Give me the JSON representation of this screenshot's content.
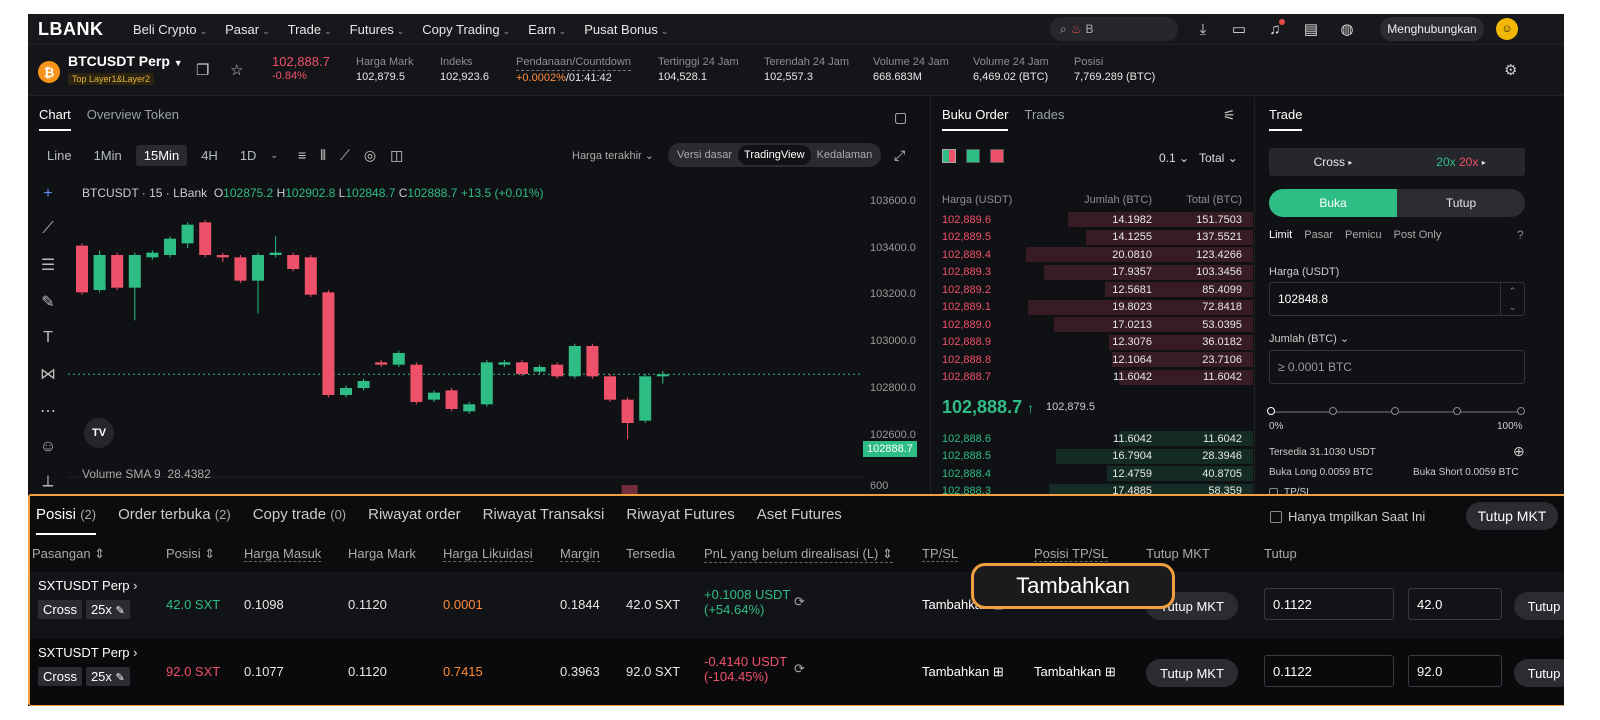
{
  "nav": {
    "logo": "LBANK",
    "items": [
      "Beli Crypto",
      "Pasar",
      "Trade",
      "Futures",
      "Copy Trading",
      "Earn",
      "Pusat Bonus"
    ],
    "search_value": "B",
    "connect_label": "Menghubungkan"
  },
  "ticker": {
    "pair": "BTCUSDT Perp",
    "tags": "Top  Layer1&Layer2",
    "last_price": "102,888.7",
    "change": "-0.84%",
    "stats": [
      {
        "label": "Harga Mark",
        "value": "102,879.5"
      },
      {
        "label": "Indeks",
        "value": "102,923.6"
      },
      {
        "label": "Pendanaan/Countdown",
        "value_a": "+0.0002%",
        "value_b": "/01:41:42"
      },
      {
        "label": "Tertinggi 24 Jam",
        "value": "104,528.1"
      },
      {
        "label": "Terendah 24 Jam",
        "value": "102,557.3"
      },
      {
        "label": "Volume 24 Jam",
        "value": "668.683M"
      },
      {
        "label": "Volume 24 Jam",
        "value": "6,469.02 (BTC)"
      },
      {
        "label": "Posisi",
        "value": "7,769.289 (BTC)"
      }
    ]
  },
  "chart": {
    "tabs": [
      "Chart",
      "Overview Token"
    ],
    "timeframes": [
      "Line",
      "1Min",
      "15Min",
      "4H",
      "1D"
    ],
    "active_timeframe": "15Min",
    "price_type": "Harga terakhir",
    "views": [
      "Versi dasar",
      "TradingView",
      "Kedalaman"
    ],
    "ohlc": {
      "title": "BTCUSDT · 15 · LBank",
      "o": "102875.2",
      "h": "102902.8",
      "l": "102848.7",
      "c": "102888.7",
      "chg": "+13.5 (+0.01%)"
    },
    "price_scale": [
      "103600.0",
      "103400.0",
      "103200.0",
      "103000.0",
      "102800.0",
      "102600.0",
      "600"
    ],
    "current_price_tag": "102888.7",
    "volume_label": "Volume SMA 9",
    "volume_value": "28.4382",
    "tv_logo": "TV"
  },
  "chart_data": {
    "type": "candlestick",
    "title": "BTCUSDT · 15 · LBank",
    "y_range": [
      102500,
      103700
    ],
    "candles": [
      {
        "o": 103440,
        "c": 103240,
        "h": 103450,
        "l": 103230
      },
      {
        "o": 103250,
        "c": 103400,
        "h": 103420,
        "l": 103240
      },
      {
        "o": 103400,
        "c": 103260,
        "h": 103410,
        "l": 103250
      },
      {
        "o": 103260,
        "c": 103400,
        "h": 103410,
        "l": 103120
      },
      {
        "o": 103390,
        "c": 103410,
        "h": 103420,
        "l": 103380
      },
      {
        "o": 103400,
        "c": 103470,
        "h": 103480,
        "l": 103390
      },
      {
        "o": 103450,
        "c": 103530,
        "h": 103540,
        "l": 103430
      },
      {
        "o": 103540,
        "c": 103400,
        "h": 103550,
        "l": 103390
      },
      {
        "o": 103400,
        "c": 103390,
        "h": 103410,
        "l": 103370
      },
      {
        "o": 103390,
        "c": 103290,
        "h": 103400,
        "l": 103280
      },
      {
        "o": 103290,
        "c": 103400,
        "h": 103410,
        "l": 103150
      },
      {
        "o": 103400,
        "c": 103410,
        "h": 103480,
        "l": 103390
      },
      {
        "o": 103400,
        "c": 103340,
        "h": 103410,
        "l": 103330
      },
      {
        "o": 103390,
        "c": 103230,
        "h": 103400,
        "l": 103220
      },
      {
        "o": 103240,
        "c": 102800,
        "h": 103250,
        "l": 102790
      },
      {
        "o": 102800,
        "c": 102830,
        "h": 102840,
        "l": 102790
      },
      {
        "o": 102830,
        "c": 102860,
        "h": 102870,
        "l": 102820
      },
      {
        "o": 102940,
        "c": 102930,
        "h": 102950,
        "l": 102920
      },
      {
        "o": 102930,
        "c": 102980,
        "h": 102990,
        "l": 102920
      },
      {
        "o": 102930,
        "c": 102770,
        "h": 102940,
        "l": 102760
      },
      {
        "o": 102780,
        "c": 102810,
        "h": 102820,
        "l": 102770
      },
      {
        "o": 102820,
        "c": 102740,
        "h": 102830,
        "l": 102730
      },
      {
        "o": 102730,
        "c": 102760,
        "h": 102770,
        "l": 102720
      },
      {
        "o": 102760,
        "c": 102940,
        "h": 102950,
        "l": 102750
      },
      {
        "o": 102930,
        "c": 102940,
        "h": 102950,
        "l": 102920
      },
      {
        "o": 102940,
        "c": 102890,
        "h": 102950,
        "l": 102880
      },
      {
        "o": 102900,
        "c": 102920,
        "h": 102930,
        "l": 102890
      },
      {
        "o": 102930,
        "c": 102880,
        "h": 102940,
        "l": 102870
      },
      {
        "o": 102880,
        "c": 103010,
        "h": 103020,
        "l": 102870
      },
      {
        "o": 103010,
        "c": 102880,
        "h": 103020,
        "l": 102870
      },
      {
        "o": 102880,
        "c": 102780,
        "h": 102890,
        "l": 102770
      },
      {
        "o": 102780,
        "c": 102680,
        "h": 102790,
        "l": 102610
      },
      {
        "o": 102690,
        "c": 102880,
        "h": 102890,
        "l": 102680
      },
      {
        "o": 102880,
        "c": 102888.7,
        "h": 102902.8,
        "l": 102848.7
      }
    ]
  },
  "orderbook": {
    "tabs": [
      "Buku Order",
      "Trades"
    ],
    "tick": "0.1",
    "mode": "Total",
    "headers": [
      "Harga (USDT)",
      "Jumlah (BTC)",
      "Total (BTC)"
    ],
    "asks": [
      {
        "p": "102,889.6",
        "a": "14.1982",
        "t": "151.7503",
        "d": 0.8
      },
      {
        "p": "102,889.5",
        "a": "14.1255",
        "t": "137.5521",
        "d": 0.72
      },
      {
        "p": "102,889.4",
        "a": "20.0810",
        "t": "123.4266",
        "d": 0.98
      },
      {
        "p": "102,889.3",
        "a": "17.9357",
        "t": "103.3456",
        "d": 0.9
      },
      {
        "p": "102,889.2",
        "a": "12.5681",
        "t": "85.4099",
        "d": 0.64
      },
      {
        "p": "102,889.1",
        "a": "19.8023",
        "t": "72.8418",
        "d": 0.97
      },
      {
        "p": "102,889.0",
        "a": "17.0213",
        "t": "53.0395",
        "d": 0.86
      },
      {
        "p": "102,888.9",
        "a": "12.3076",
        "t": "36.0182",
        "d": 0.62
      },
      {
        "p": "102,888.8",
        "a": "12.1064",
        "t": "23.7106",
        "d": 0.61
      },
      {
        "p": "102,888.7",
        "a": "11.6042",
        "t": "11.6042",
        "d": 0.58
      }
    ],
    "mid_price": "102,888.7",
    "mid_arrow": "↑",
    "mid_mark": "102,879.5",
    "bids": [
      {
        "p": "102,888.6",
        "a": "11.6042",
        "t": "11.6042",
        "d": 0.58
      },
      {
        "p": "102,888.5",
        "a": "16.7904",
        "t": "28.3946",
        "d": 0.85
      },
      {
        "p": "102,888.4",
        "a": "12.4759",
        "t": "40.8705",
        "d": 0.63
      },
      {
        "p": "102,888.3",
        "a": "17.4885",
        "t": "58.359",
        "d": 0.88
      }
    ]
  },
  "trade": {
    "tab": "Trade",
    "cross": "Cross",
    "lev_a": "20x",
    "lev_b": "20x",
    "open": "Buka",
    "close": "Tutup",
    "order_types": [
      "Limit",
      "Pasar",
      "Pemicu",
      "Post Only"
    ],
    "price_label": "Harga (USDT)",
    "price_value": "102848.8",
    "qty_label": "Jumlah (BTC)",
    "qty_placeholder": "≥ 0.0001 BTC",
    "slider_min": "0%",
    "slider_max": "100%",
    "available": "Tersedia 31.1030 USDT",
    "buy_long": "Buka Long 0.0059 BTC",
    "buy_short": "Buka Short 0.0059 BTC",
    "tpsl": "TP/SL"
  },
  "positions": {
    "tabs": [
      {
        "label": "Posisi",
        "count": "(2)"
      },
      {
        "label": "Order terbuka",
        "count": "(2)"
      },
      {
        "label": "Copy trade",
        "count": "(0)"
      },
      {
        "label": "Riwayat order",
        "count": ""
      },
      {
        "label": "Riwayat Transaksi",
        "count": ""
      },
      {
        "label": "Riwayat Futures",
        "count": ""
      },
      {
        "label": "Aset Futures",
        "count": ""
      }
    ],
    "show_current_only": "Hanya tmpilkan Saat Ini",
    "close_all_label": "Tutup MKT",
    "headers": [
      "Pasangan ⇕",
      "Posisi ⇕",
      "Harga Masuk",
      "Harga Mark",
      "Harga Likuidasi",
      "Margin",
      "Tersedia",
      "PnL yang belum direalisasi (L) ⇕",
      "TP/SL",
      "Posisi TP/SL",
      "Tutup MKT",
      "Tutup"
    ],
    "rows": [
      {
        "pair": "SXTUSDT Perp",
        "mode": "Cross",
        "lev": "25x",
        "size": "42.0 SXT",
        "entry": "0.1098",
        "mark": "0.1120",
        "liq": "0.0001",
        "margin": "0.1844",
        "avail": "42.0 SXT",
        "pnl": "+0.1008 USDT",
        "pnl_pct": "(+54.64%)",
        "tpsl": "Tambahkan",
        "pos_tpsl": "Tambahkan",
        "mkt": "Tutup MKT",
        "price": "0.1122",
        "qty": "42.0",
        "close": "Tutup"
      },
      {
        "pair": "SXTUSDT Perp",
        "mode": "Cross",
        "lev": "25x",
        "size": "92.0 SXT",
        "entry": "0.1077",
        "mark": "0.1120",
        "liq": "0.7415",
        "margin": "0.3963",
        "avail": "92.0 SXT",
        "pnl": "-0.4140 USDT",
        "pnl_pct": "(-104.45%)",
        "tpsl": "Tambahkan",
        "pos_tpsl": "Tambahkan",
        "mkt": "Tutup MKT",
        "price": "0.1122",
        "qty": "92.0",
        "close": "Tutup"
      }
    ]
  },
  "tooltip": {
    "label": "Tambahkan"
  },
  "colors": {
    "up": "#2ebd85",
    "down": "#f0516a",
    "highlight": "#f0a040",
    "bg": "#101114"
  }
}
